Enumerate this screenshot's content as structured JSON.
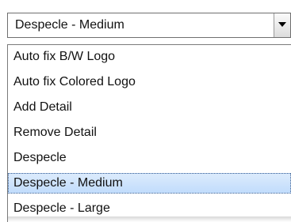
{
  "dropdown": {
    "selected_value": "Despecle - Medium",
    "options": [
      {
        "label": "Auto fix B/W Logo"
      },
      {
        "label": "Auto fix Colored Logo"
      },
      {
        "label": "Add Detail"
      },
      {
        "label": "Remove Detail"
      },
      {
        "label": "Despecle"
      },
      {
        "label": "Despecle - Medium",
        "selected": true
      },
      {
        "label": "Despecle - Large"
      }
    ],
    "arrow_icon": "chevron-down-icon",
    "colors": {
      "border": "#6f6f6f",
      "highlight_top": "#dcebfc",
      "highlight_bottom": "#c1dcfc",
      "focus_border": "#3c5f91"
    }
  }
}
